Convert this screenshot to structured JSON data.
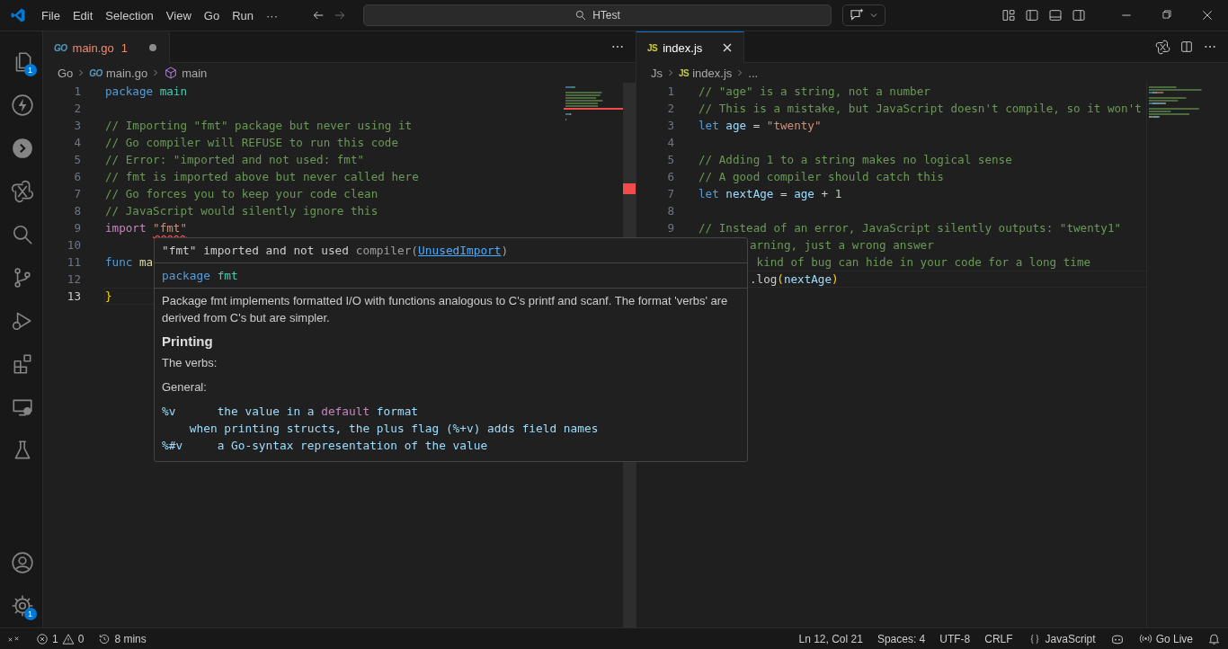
{
  "title_bar": {
    "menu": [
      "File",
      "Edit",
      "Selection",
      "View",
      "Go",
      "Run",
      "···"
    ],
    "search": {
      "value": "HTest"
    }
  },
  "activity_bar": {
    "items": [
      {
        "kind": "files",
        "badge": "1"
      },
      {
        "kind": "bolt"
      },
      {
        "kind": "remote"
      },
      {
        "kind": "knot"
      },
      {
        "kind": "search"
      },
      {
        "kind": "branch"
      },
      {
        "kind": "debug"
      },
      {
        "kind": "extensions"
      },
      {
        "kind": "monitor"
      },
      {
        "kind": "flask"
      }
    ],
    "bottom": [
      {
        "kind": "account"
      },
      {
        "kind": "settings",
        "badge": "1"
      }
    ]
  },
  "editors": [
    {
      "focused": false,
      "tab": {
        "icon": "GO",
        "label": "main.go",
        "problems": "1",
        "dirty": true,
        "error": true,
        "selected": true
      },
      "breadcrumbs": [
        {
          "kind": "folder",
          "text": "Go"
        },
        {
          "kind": "file",
          "icon": "GO",
          "text": "main.go"
        },
        {
          "kind": "symbol",
          "text": "main"
        }
      ],
      "lines": [
        {
          "number": "1",
          "current": false,
          "tokens": [
            {
              "kind": "keyword",
              "text": "package"
            },
            {
              "kind": "type",
              "text": " main"
            }
          ]
        },
        {
          "number": "2",
          "current": false
        },
        {
          "number": "3",
          "current": false,
          "tokens": [
            {
              "kind": "comment",
              "text": "// Importing \"fmt\" package but never using it"
            }
          ]
        },
        {
          "number": "4",
          "current": false,
          "tokens": [
            {
              "kind": "comment",
              "text": "// Go compiler will REFUSE to run this code"
            }
          ]
        },
        {
          "number": "5",
          "current": false,
          "tokens": [
            {
              "kind": "comment",
              "text": "// Error: \"imported and not used: fmt\""
            }
          ]
        },
        {
          "number": "6",
          "current": false,
          "tokens": [
            {
              "kind": "comment",
              "text": "// fmt is imported above but never called here"
            }
          ]
        },
        {
          "number": "7",
          "current": false,
          "tokens": [
            {
              "kind": "comment",
              "text": "// Go forces you to keep your code clean"
            }
          ]
        },
        {
          "number": "8",
          "current": false,
          "tokens": [
            {
              "kind": "comment",
              "text": "// JavaScript would silently ignore this"
            }
          ]
        },
        {
          "number": "9",
          "current": false,
          "tokens": [
            {
              "kind": "control",
              "text": "import "
            },
            {
              "kind": "error-string",
              "text": "\"fmt\""
            }
          ]
        },
        {
          "number": "10",
          "current": false
        },
        {
          "number": "11",
          "current": false,
          "tokens": [
            {
              "kind": "keyword",
              "text": "func "
            },
            {
              "kind": "function",
              "text": "ma"
            }
          ]
        },
        {
          "number": "12",
          "current": false
        },
        {
          "number": "13",
          "current": true,
          "tokens": [
            {
              "kind": "bracket",
              "text": "}"
            }
          ]
        }
      ]
    },
    {
      "focused": true,
      "tab": {
        "icon": "JS",
        "label": "index.js",
        "dirty": false,
        "error": false,
        "selected": true
      },
      "breadcrumbs": [
        {
          "kind": "folder",
          "text": "Js"
        },
        {
          "kind": "file",
          "icon": "JS",
          "text": "index.js"
        },
        {
          "kind": "more",
          "text": "..."
        }
      ],
      "lines": [
        {
          "number": "1",
          "current": false,
          "tokens": [
            {
              "kind": "comment",
              "text": "// \"age\" is a string, not a number"
            }
          ]
        },
        {
          "number": "2",
          "current": false,
          "tokens": [
            {
              "kind": "comment",
              "text": "// This is a mistake, but JavaScript doesn't compile, so it won't"
            }
          ]
        },
        {
          "number": "3",
          "current": false,
          "tokens": [
            {
              "kind": "keyword",
              "text": "let "
            },
            {
              "kind": "variable",
              "text": "age"
            },
            {
              "kind": "plain",
              "text": " = "
            },
            {
              "kind": "string",
              "text": "\"twenty\""
            }
          ]
        },
        {
          "number": "4",
          "current": false
        },
        {
          "number": "5",
          "current": false,
          "tokens": [
            {
              "kind": "comment",
              "text": "// Adding 1 to a string makes no logical sense"
            }
          ]
        },
        {
          "number": "6",
          "current": false,
          "tokens": [
            {
              "kind": "comment",
              "text": "// A good compiler should catch this"
            }
          ]
        },
        {
          "number": "7",
          "current": false,
          "tokens": [
            {
              "kind": "keyword",
              "text": "let "
            },
            {
              "kind": "variable",
              "text": "nextAge"
            },
            {
              "kind": "plain",
              "text": " = "
            },
            {
              "kind": "variable",
              "text": "age"
            },
            {
              "kind": "plain",
              "text": " + "
            },
            {
              "kind": "number",
              "text": "1"
            }
          ]
        },
        {
          "number": "8",
          "current": false
        },
        {
          "number": "9",
          "current": false,
          "tokens": [
            {
              "kind": "comment",
              "text": "// Instead of an error, JavaScript silently outputs: \"twenty1\""
            }
          ]
        },
        {
          "current": false,
          "tokens": [
            {
              "kind": "comment",
              "text": "arning, just a wrong answer"
            }
          ]
        },
        {
          "current": false,
          "tokens": [
            {
              "kind": "comment",
              "text": " kind of bug can hide in your code for a long time"
            }
          ]
        },
        {
          "current": true,
          "tokens": [
            {
              "kind": "plain",
              "text": ".log"
            },
            {
              "kind": "bracket",
              "text": "("
            },
            {
              "kind": "variable",
              "text": "nextAge"
            },
            {
              "kind": "bracket",
              "text": ")"
            }
          ]
        }
      ]
    }
  ],
  "hover": {
    "message": [
      {
        "kind": "plain",
        "text": "\"fmt\" imported and not used "
      },
      {
        "kind": "muted",
        "text": "compiler("
      },
      {
        "kind": "link",
        "text": "UnusedImport"
      },
      {
        "kind": "muted",
        "text": ")"
      }
    ],
    "signature": [
      {
        "kind": "keyword",
        "text": "package "
      },
      {
        "kind": "type",
        "text": "fmt"
      }
    ],
    "docs": [
      {
        "kind": "paragraph",
        "text": "Package fmt implements formatted I/O with functions analogous to C's printf and scanf. The format 'verbs' are derived from C's but are simpler."
      },
      {
        "kind": "heading",
        "text": "Printing"
      },
      {
        "kind": "paragraph",
        "text": "The verbs:"
      },
      {
        "kind": "paragraph",
        "text": "General:"
      },
      {
        "kind": "code",
        "tokens": [
          {
            "kind": "variable",
            "text": "%v      the value in a "
          },
          {
            "kind": "control",
            "text": "default"
          },
          {
            "kind": "variable",
            "text": " format"
          }
        ]
      },
      {
        "kind": "code",
        "tokens": [
          {
            "kind": "variable",
            "text": "    when printing structs, the plus flag (%+v) adds field names"
          }
        ]
      },
      {
        "kind": "code",
        "tokens": [
          {
            "kind": "variable",
            "text": "%#v     a Go-syntax representation of the value"
          }
        ]
      }
    ]
  },
  "status_bar": {
    "errors": "1",
    "warnings": "0",
    "history": "8 mins",
    "position": "Ln 12, Col 21",
    "indent": "Spaces: 4",
    "encoding": "UTF-8",
    "eol": "CRLF",
    "language": "JavaScript",
    "live": "Go Live"
  }
}
